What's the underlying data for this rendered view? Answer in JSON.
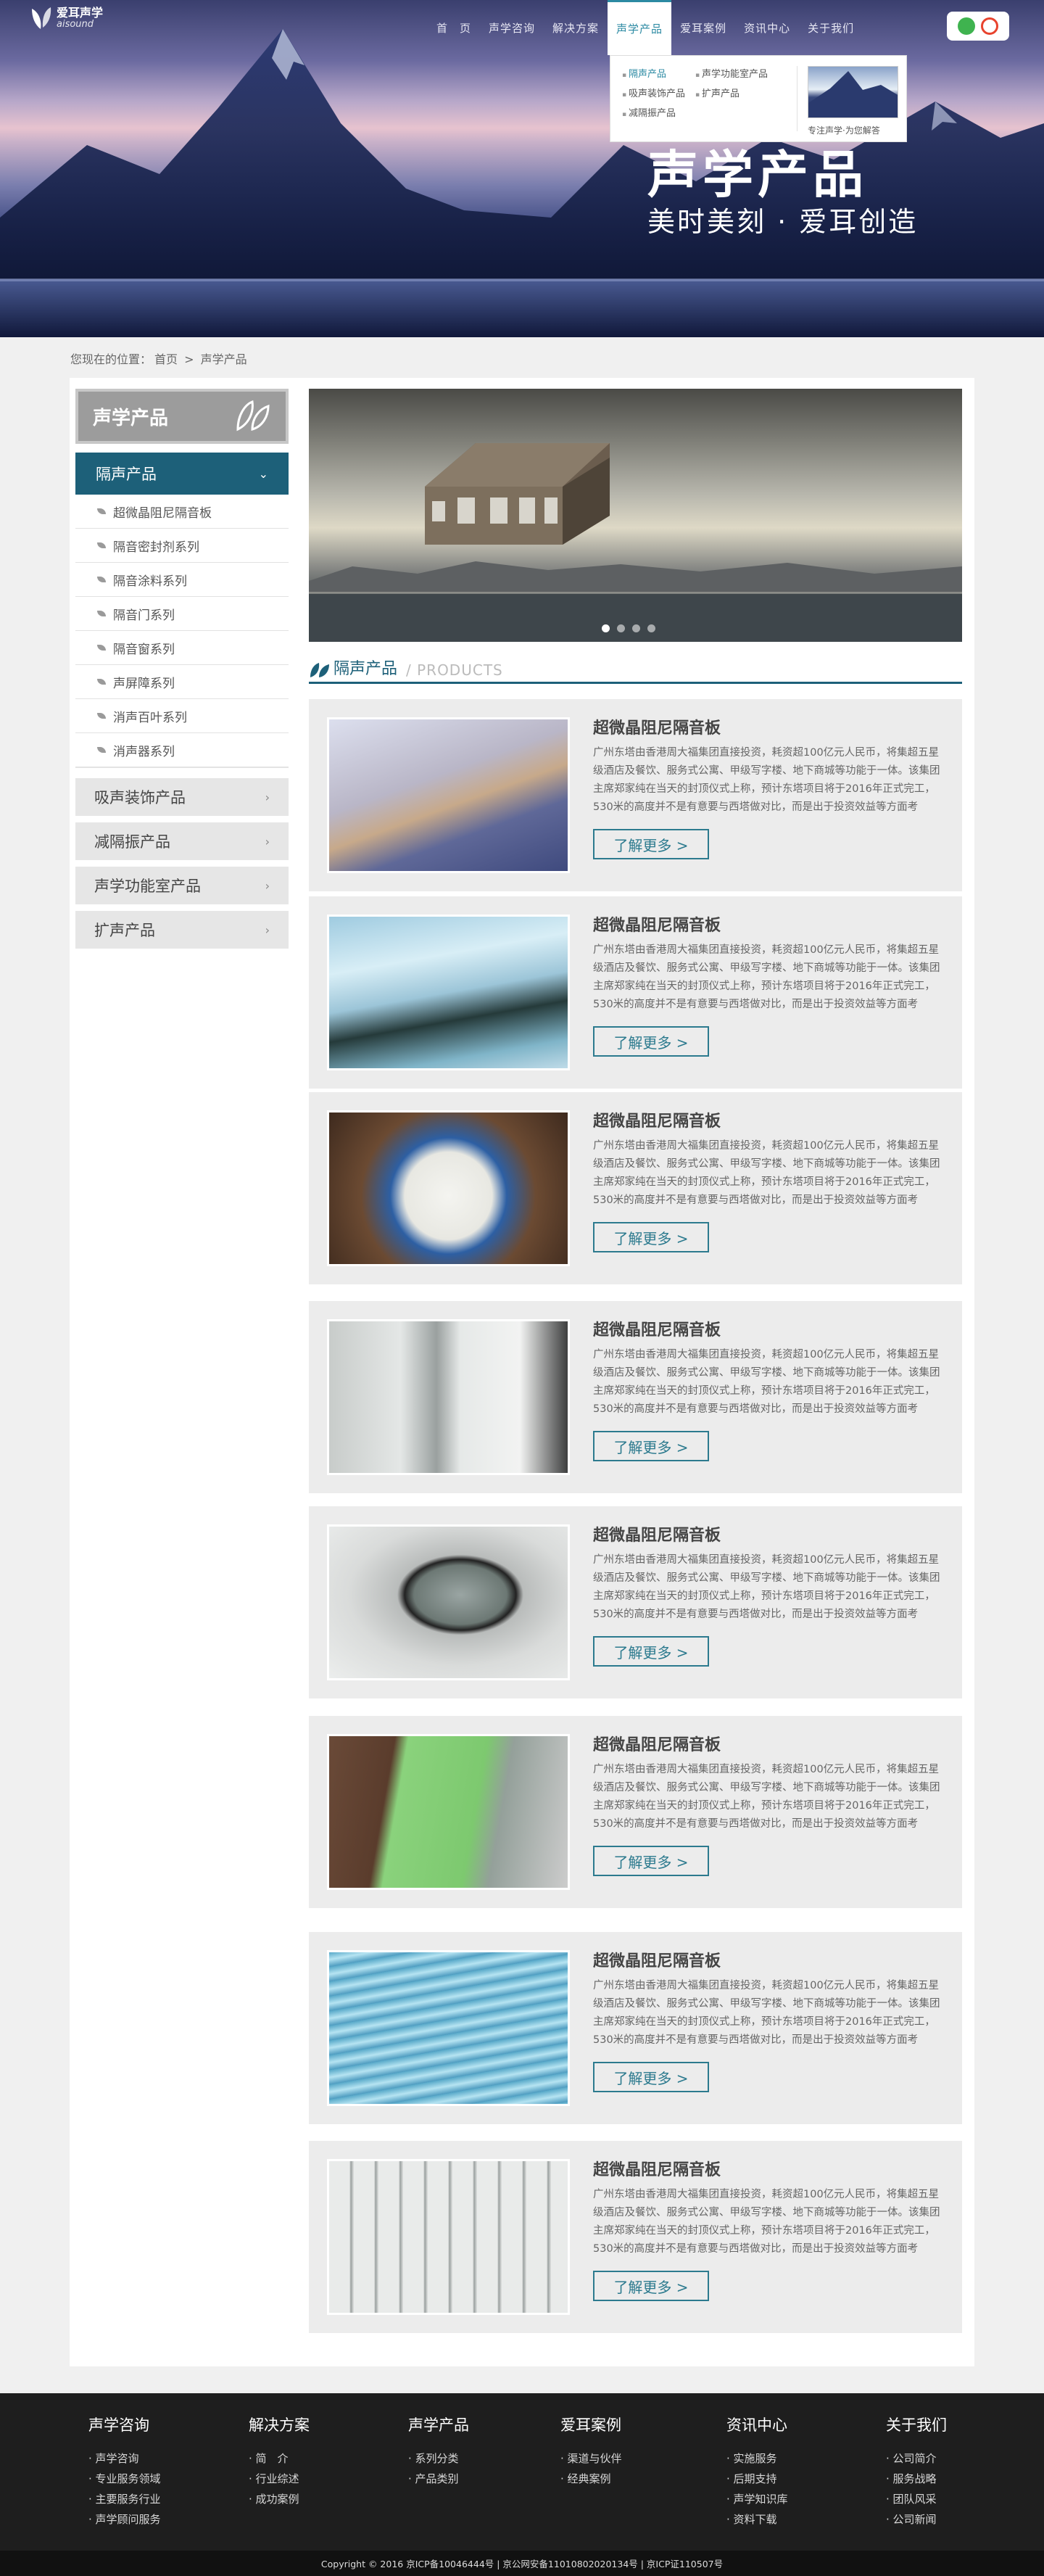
{
  "header": {
    "logo_name": "爱耳声学",
    "logo_sub": "aisound",
    "nav": [
      "首　页",
      "声学咨询",
      "解决方案",
      "声学产品",
      "爱耳案例",
      "资讯中心",
      "关于我们"
    ],
    "active_nav": "声学产品",
    "social": [
      "wechat-icon",
      "weibo-icon"
    ]
  },
  "dropdown": {
    "links": [
      "隔声产品",
      "声学功能室产品",
      "吸声装饰产品",
      "扩声产品",
      "减隔振产品"
    ],
    "caption": "专注声学·为您解答"
  },
  "hero": {
    "title": "声学产品",
    "slogan": "美时美刻 · 爱耳创造"
  },
  "breadcrumb": {
    "prefix": "您现在的位置：",
    "home": "首页",
    "sep": ">",
    "current": "声学产品"
  },
  "sidebar": {
    "title": "声学产品",
    "group": "隔声产品",
    "items": [
      "超微晶阻尼隔音板",
      "隔音密封剂系列",
      "隔音涂料系列",
      "隔音门系列",
      "隔音窗系列",
      "声屏障系列",
      "消声百叶系列",
      "消声器系列"
    ],
    "categories": [
      "吸声装饰产品",
      "减隔振产品",
      "声学功能室产品",
      "扩声产品"
    ]
  },
  "section": {
    "title_cn": "隔声产品",
    "title_en": "/ PRODUCTS"
  },
  "products": [
    {
      "title": "超微晶阻尼隔音板",
      "more": "了解更多 >",
      "image": "panel-board"
    },
    {
      "title": "超微晶阻尼隔音板",
      "more": "了解更多 >",
      "image": "sealant-tube"
    },
    {
      "title": "超微晶阻尼隔音板",
      "more": "了解更多 >",
      "image": "paint-bucket"
    },
    {
      "title": "超微晶阻尼隔音板",
      "more": "了解更多 >",
      "image": "door"
    },
    {
      "title": "超微晶阻尼隔音板",
      "more": "了解更多 >",
      "image": "window"
    },
    {
      "title": "超微晶阻尼隔音板",
      "more": "了解更多 >",
      "image": "green-barrier"
    },
    {
      "title": "超微晶阻尼隔音板",
      "more": "了解更多 >",
      "image": "louver"
    },
    {
      "title": "超微晶阻尼隔音板",
      "more": "了解更多 >",
      "image": "silencer"
    }
  ],
  "product_desc": "广州东塔由香港周大福集团直接投资，耗资超100亿元人民币，将集超五星级酒店及餐饮、服务式公寓、甲级写字楼、地下商城等功能于一体。该集团主席郑家纯在当天的封顶仪式上称，预计东塔项目将于2016年正式完工，530米的高度并不是有意要与西塔做对比，而是出于投资效益等方面考虑，“通常楼层越高，景观越好，",
  "footer": {
    "columns": [
      {
        "heading": "声学咨询",
        "links": [
          "声学咨询",
          "专业服务领域",
          "主要服务行业",
          "声学顾问服务"
        ]
      },
      {
        "heading": "解决方案",
        "links": [
          "简　介",
          "行业综述",
          "成功案例"
        ]
      },
      {
        "heading": "声学产品",
        "links": [
          "系列分类",
          "产品类别"
        ]
      },
      {
        "heading": "爱耳案例",
        "links": [
          "渠道与伙伴",
          "经典案例"
        ]
      },
      {
        "heading": "资讯中心",
        "links": [
          "实施服务",
          "后期支持",
          "声学知识库",
          "资料下载"
        ]
      },
      {
        "heading": "关于我们",
        "links": [
          "公司简介",
          "服务战略",
          "团队风采",
          "公司新闻"
        ]
      }
    ],
    "copyright": "Copyright © 2016  京ICP备10046444号 | 京公网安备11010802020134号 | 京ICP证110507号"
  },
  "colors": {
    "accent": "#1d6079",
    "link": "#2c8aa3",
    "footer_bg": "#1e1e1e"
  }
}
